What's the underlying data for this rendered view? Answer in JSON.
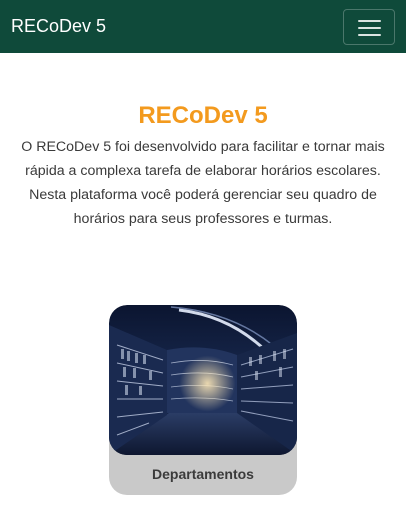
{
  "navbar": {
    "brand": "RECoDev 5",
    "menu_icon": "hamburger-menu-icon"
  },
  "hero": {
    "title": "RECoDev 5",
    "description": "O RECoDev 5 foi desenvolvido para facilitar e tornar mais rápida a complexa tarefa de elaborar horários escolares. Nesta plataforma você poderá gerenciar seu quadro de horários para seus professores e turmas."
  },
  "cards": [
    {
      "label": "Departamentos",
      "image": "library-shelves-image"
    }
  ],
  "colors": {
    "navbar": "#0f4a3a",
    "title": "#f39a1e",
    "card_bg": "#c9c9c9"
  }
}
